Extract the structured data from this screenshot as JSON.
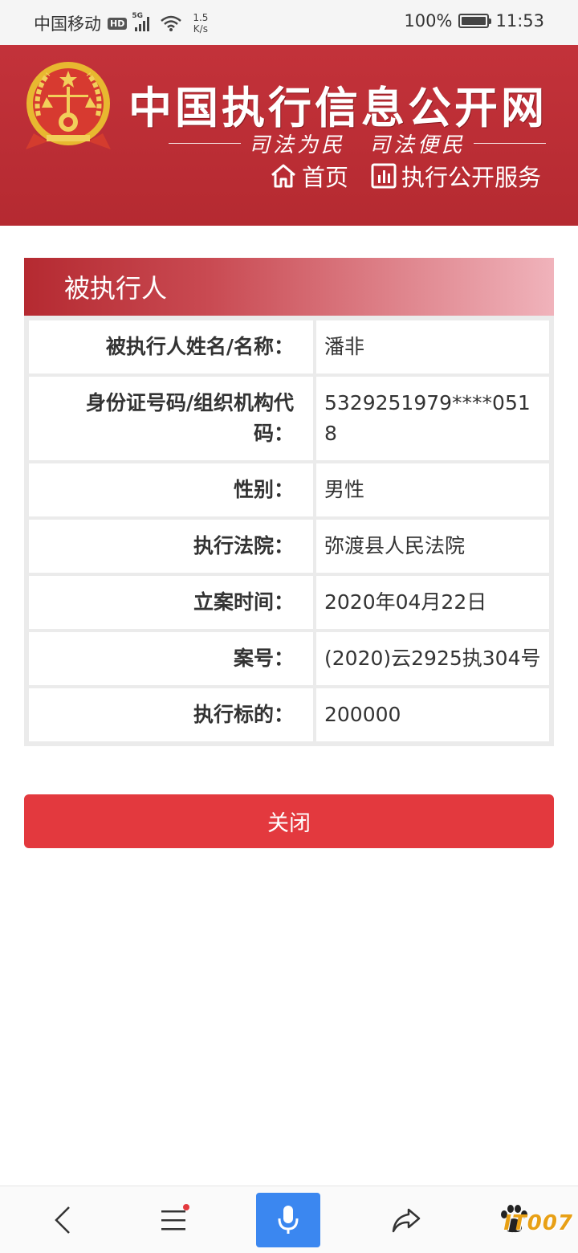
{
  "status_bar": {
    "carrier": "中国移动",
    "hd": "HD",
    "network": "5G",
    "speed_value": "1.5",
    "speed_unit": "K/s",
    "battery": "100%",
    "battery_level": 1.0,
    "time": "11:53"
  },
  "header": {
    "site_title": "中国执行信息公开网",
    "slogan": "司法为民　司法便民",
    "nav": [
      {
        "label": "首页",
        "icon": "home-icon"
      },
      {
        "label": "执行公开服务",
        "icon": "bar-chart-icon"
      }
    ]
  },
  "panel": {
    "title": "被执行人",
    "rows": [
      {
        "label": "被执行人姓名/名称：",
        "value": "潘非"
      },
      {
        "label": "身份证号码/组织机构代码：",
        "value": "5329251979****0518"
      },
      {
        "label": "性别：",
        "value": "男性"
      },
      {
        "label": "执行法院：",
        "value": "弥渡县人民法院"
      },
      {
        "label": "立案时间：",
        "value": "2020年04月22日"
      },
      {
        "label": "案号：",
        "value": "(2020)云2925执304号"
      },
      {
        "label": "执行标的：",
        "value": "200000"
      }
    ]
  },
  "close_button": {
    "label": "关闭"
  },
  "bottom_bar": {
    "icons": [
      "back-icon",
      "menu-icon",
      "microphone-icon",
      "share-icon",
      "paw-icon"
    ]
  },
  "watermark": "IT007",
  "colors": {
    "header": "#b52a31",
    "button": "#e3393e",
    "mic": "#3b87f0"
  }
}
